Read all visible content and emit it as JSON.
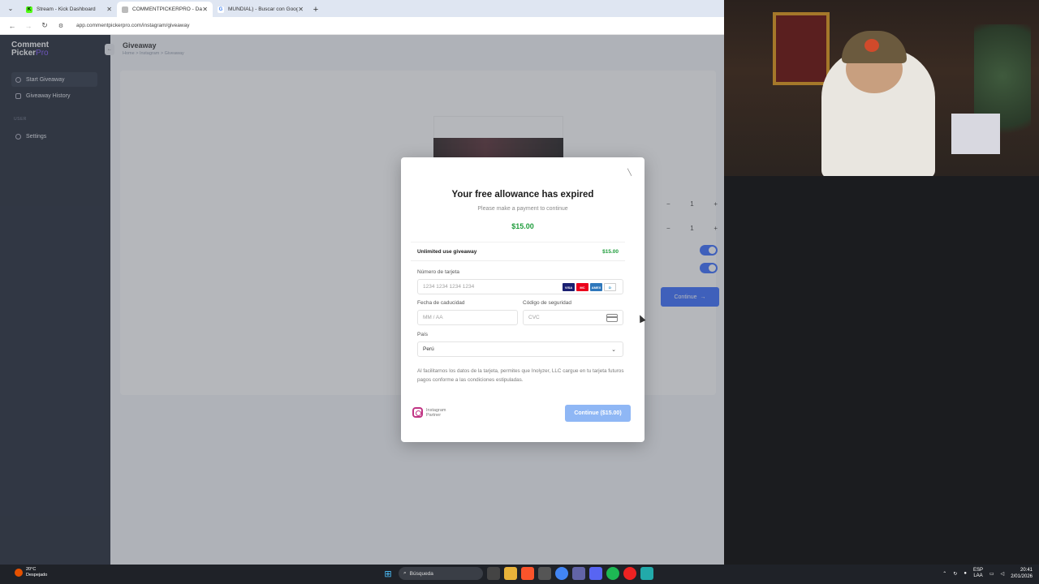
{
  "browser": {
    "tabs": [
      {
        "title": "Stream - Kick Dashboard",
        "favicon_color": "#53fc18",
        "favicon_letter": "K"
      },
      {
        "title": "COMMENTPICKERPRO - Dashb",
        "favicon_color": "#8b8b8b",
        "favicon_letter": ""
      },
      {
        "title": "MUNDIAL) - Buscar con Google",
        "favicon_color": "#4285f4",
        "favicon_letter": "G"
      }
    ],
    "url": "app.commentpickerpro.com/instagram/giveaway"
  },
  "sidebar": {
    "logo_line1": "Comment",
    "logo_line2a": "Picker",
    "logo_line2b": "Pro",
    "items": [
      {
        "label": "Start Giveaway"
      },
      {
        "label": "Giveaway History"
      }
    ],
    "section_user": "USER",
    "settings_label": "Settings"
  },
  "main": {
    "title": "Giveaway",
    "breadcrumb": "Home  >  Instagram  >  Giveaway",
    "stepper_values": [
      "1",
      "1"
    ],
    "continue_label": "Continue"
  },
  "modal": {
    "title": "Your free allowance has expired",
    "subtitle": "Please make a payment to continue",
    "price": "$15.00",
    "summary_label": "Unlimited use giveaway",
    "summary_value": "$15.00",
    "card_label": "Número de tarjeta",
    "card_placeholder": "1234 1234 1234 1234",
    "card_brands": [
      "VISA",
      "MC",
      "AMEX",
      "D"
    ],
    "expiry_label": "Fecha de caducidad",
    "expiry_placeholder": "MM / AA",
    "cvc_label": "Código de seguridad",
    "cvc_placeholder": "CVC",
    "country_label": "País",
    "country_value": "Perú",
    "disclaimer": "Al facilitarnos los datos de la tarjeta, permites que Inolyzer, LLC cargue en tu tarjeta futuros pagos conforme a las condiciones estipuladas.",
    "badge_line1": "Instagram",
    "badge_line2": "Partner",
    "pay_button": "Continue ($15.00)"
  },
  "taskbar": {
    "weather_temp": "20°C",
    "weather_desc": "Despejado",
    "search_placeholder": "Búsqueda",
    "lang_line1": "ESP",
    "lang_line2": "LAA",
    "time": "20:41",
    "date": "2/01/2026"
  },
  "colors": {
    "accent": "#2962ff",
    "price_green": "#1f9d3c",
    "sidebar_bg": "#0f1626"
  }
}
